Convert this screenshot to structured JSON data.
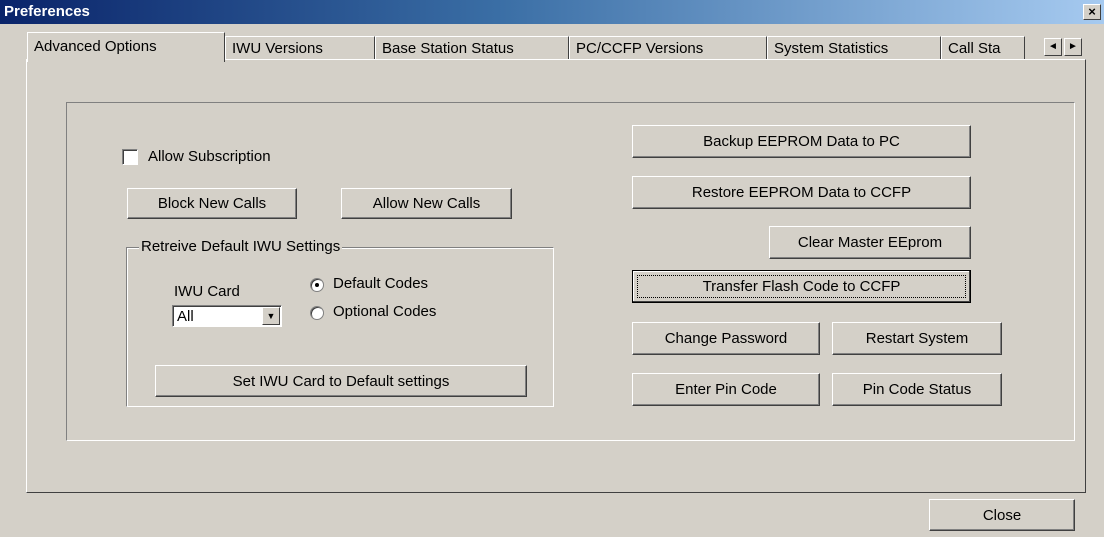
{
  "window": {
    "title": "Preferences",
    "close_glyph": "×"
  },
  "tabs": [
    {
      "label": "Advanced Options"
    },
    {
      "label": "IWU Versions"
    },
    {
      "label": "Base Station Status"
    },
    {
      "label": "PC/CCFP Versions"
    },
    {
      "label": "System Statistics"
    },
    {
      "label": "Call Sta"
    }
  ],
  "tab_scroll": {
    "left": "◄",
    "right": "►"
  },
  "advanced": {
    "allow_subscription": "Allow Subscription",
    "block_new_calls": "Block New Calls",
    "allow_new_calls": "Allow New Calls",
    "group_title": "Retreive Default IWU Settings",
    "iwu_card_label": "IWU Card",
    "iwu_card_value": "All",
    "dropdown_glyph": "▼",
    "default_codes": "Default Codes",
    "optional_codes": "Optional Codes",
    "set_default": "Set IWU Card to Default settings",
    "backup_eeprom": "Backup EEPROM Data to PC",
    "restore_eeprom": "Restore EEPROM Data to CCFP",
    "clear_master": "Clear Master EEprom",
    "transfer_flash": "Transfer Flash Code to CCFP",
    "change_password": "Change Password",
    "restart_system": "Restart System",
    "enter_pin": "Enter Pin Code",
    "pin_status": "Pin Code Status"
  },
  "footer": {
    "close": "Close"
  }
}
